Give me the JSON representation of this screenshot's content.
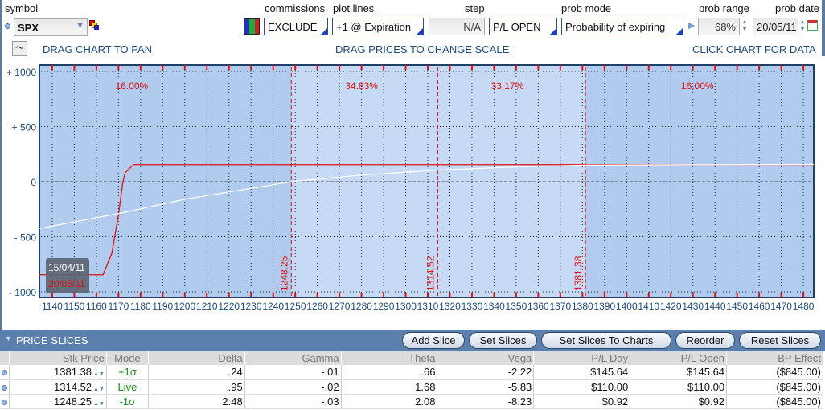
{
  "header": {
    "symbol_label": "symbol",
    "symbol": "SPX",
    "commissions_label": "commissions",
    "commissions": "EXCLUDE",
    "plot_lines_label": "plot lines",
    "plot_lines": "+1 @ Expiration",
    "step_label": "step",
    "step": "N/A",
    "pl_mode": "P/L OPEN",
    "prob_mode_label": "prob mode",
    "prob_mode": "Probability of expiring",
    "prob_range_label": "prob range",
    "prob_range": "68%",
    "prob_date_label": "prob date",
    "prob_date": "20/05/11"
  },
  "hints": {
    "pan": "DRAG CHART TO PAN",
    "scale": "DRAG PRICES TO CHANGE SCALE",
    "data": "CLICK CHART FOR DATA"
  },
  "chart_data": {
    "type": "line",
    "xlim": [
      1134.2,
      1484.7
    ],
    "ylim": [
      -1000,
      1000
    ],
    "x_ticks": [
      1140,
      1150,
      1160,
      1170,
      1180,
      1190,
      1200,
      1210,
      1220,
      1230,
      1240,
      1250,
      1260,
      1270,
      1280,
      1290,
      1300,
      1310,
      1320,
      1330,
      1340,
      1350,
      1360,
      1370,
      1380,
      1390,
      1400,
      1410,
      1420,
      1430,
      1440,
      1450,
      1460,
      1470,
      1480
    ],
    "y_ticks": [
      {
        "v": 1000,
        "label": "+ 1000"
      },
      {
        "v": 500,
        "label": "+ 500"
      },
      {
        "v": 0,
        "label": "0"
      },
      {
        "v": -500,
        "label": "- 500"
      },
      {
        "v": -1000,
        "label": "- 1000"
      }
    ],
    "slice_lines": [
      {
        "x": 1248.25,
        "label": "1248.25"
      },
      {
        "x": 1314.52,
        "label": "1314.52"
      },
      {
        "x": 1381.38,
        "label": "1381.38"
      }
    ],
    "prob_labels": [
      {
        "x": 1176,
        "label": "16.00%"
      },
      {
        "x": 1280,
        "label": "34.83%"
      },
      {
        "x": 1346,
        "label": "33.17%"
      },
      {
        "x": 1432,
        "label": "16.00%"
      }
    ],
    "series": [
      {
        "name": "20/05/11",
        "color": "#e01010",
        "x": [
          1134.2,
          1163,
          1167,
          1170,
          1172,
          1173,
          1174,
          1176,
          1177,
          1484.7
        ],
        "y": [
          -845,
          -845,
          -650,
          -300,
          0,
          80,
          100,
          140,
          155,
          155
        ]
      },
      {
        "name": "15/04/11",
        "color": "#ffffff",
        "x": [
          1134.2,
          1170,
          1200,
          1230,
          1248.25,
          1280,
          1314.52,
          1350,
          1381.38,
          1430,
          1484.7
        ],
        "y": [
          -425,
          -290,
          -160,
          -60,
          0,
          60,
          105,
          135,
          150,
          155,
          157
        ]
      }
    ],
    "legend": [
      "15/04/11",
      "20/05/11"
    ],
    "colors": {
      "outer": "#b1cbef",
      "inner": "#c6daf5",
      "red": "#e01010"
    }
  },
  "slices": {
    "title": "PRICE SLICES",
    "buttons": [
      "Add Slice",
      "Set Slices",
      "Set Slices To Charts",
      "Reorder",
      "Reset Slices"
    ],
    "columns": [
      "Stk Price",
      "Mode",
      "Delta",
      "Gamma",
      "Theta",
      "Vega",
      "P/L Day",
      "P/L Open",
      "BP Effect"
    ],
    "rows": [
      [
        "1381.38",
        "+1σ",
        ".24",
        "-.01",
        ".66",
        "-2.22",
        "$145.64",
        "$145.64",
        "($845.00)"
      ],
      [
        "1314.52",
        "Live",
        ".95",
        "-.02",
        "1.68",
        "-5.83",
        "$110.00",
        "$110.00",
        "($845.00)"
      ],
      [
        "1248.25",
        "-1σ",
        "2.48",
        "-.03",
        "2.08",
        "-8.23",
        "$0.92",
        "$0.92",
        "($845.00)"
      ]
    ]
  }
}
